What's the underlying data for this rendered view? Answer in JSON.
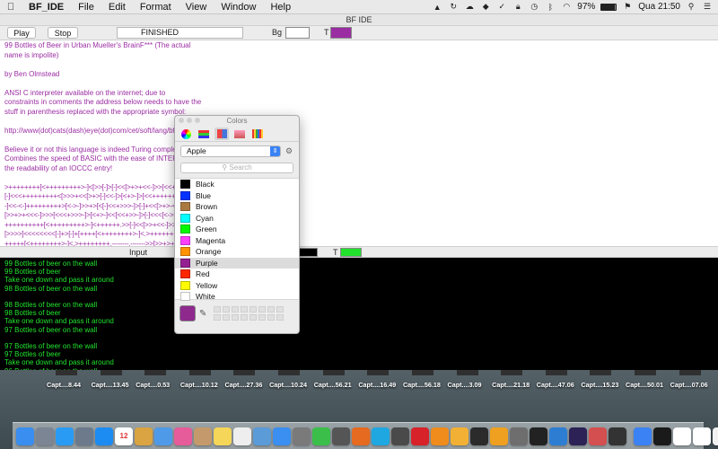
{
  "menubar": {
    "apple_glyph": "",
    "items": [
      "BF_IDE",
      "File",
      "Edit",
      "Format",
      "View",
      "Window",
      "Help"
    ],
    "battery": "97%",
    "clock": "Qua 21:50"
  },
  "window": {
    "title": "BF IDE",
    "play_label": "Play",
    "stop_label": "Stop",
    "status": "FINISHED",
    "bg_label": "Bg",
    "t_label": "T",
    "bg_color": "#ffffff",
    "t_color": "#9b2da3",
    "input_label": "Input",
    "input_bg_color": "#000000",
    "input_t_label": "T",
    "input_t_color": "#22e22e"
  },
  "editor": {
    "lines": [
      "99 Bottles of Beer in Urban Mueller's BrainF*** (The actual",
      "name is impolite)",
      "",
      "by Ben Olmstead",
      "",
      "ANSI C interpreter available on the internet; due to",
      "constraints in comments the address below needs to have the",
      "stuff in parenthesis replaced with the appropriate symbol:",
      "",
      "http://www(dot)cats(dash)eye(dot)com/cet/soft/lang/bf/",
      "",
      "Believe it or not this language is indeed Turing complete!",
      "Combines the speed of BASIC with the ease of INTERCAL and",
      "the readability of an IOCCC entry!",
      "",
      ">++++++++[<+++++++++>-]<[>>[-]>[-]<<[>+>+<<-]>>[<<+>>-]>>>",
      "[-]<<<+++++++++<[>>>+<<[>+>[-]<<-]>[<+>-]>[<<++++++++++>>>+<",
      "-]<<-<-]+++++++++>[<->-]>>+>[<[-]<<+>>>-]>[-]+<<[>+>-<<-]<<<",
      "[>>+>+<<<-]>>>[<<<+>>>-]>[<+>-]<<[<<+>>-]>[-]<<<[<->>+<<-]",
      "++++++++++[<+++++++++>-]<++++++.>>[-]<<[>>+<<-]>>[<<+>>-]<",
      "[>>>>]<<<<<<<<[-]+>[-]+[++++[<++++++++>-]<.>++++++++[<++++++",
      "+++++[<++++++++>-]<.>++++++++.--------.------->>[>>+>+<<<-]",
      ">>>[<<<+>>>-]<[<<<<+>>>>-]<[-]>[<+<+>>-]>>>>[-]<<<<<[<<<<",
      "+>-]<.>++++++++[<++++++++>-]<.-------------->>[-]<<<<<<<<"
    ]
  },
  "output": {
    "lines": [
      "99 Bottles of beer on the wall",
      "99 Bottles of beer",
      "Take one down and pass it around",
      "98 Bottles of beer on the wall",
      "",
      "98 Bottles of beer on the wall",
      "98 Bottles of beer",
      "Take one down and pass it around",
      "97 Bottles of beer on the wall",
      "",
      "97 Bottles of beer on the wall",
      "97 Bottles of beer",
      "Take one down and pass it around",
      "96 Bottles of beer on the wall",
      "",
      "96 Bottles of beer on the wall"
    ]
  },
  "colors_panel": {
    "title": "Colors",
    "palette": "Apple",
    "search_placeholder": "Search",
    "selected_color": "#8e2a8e",
    "items": [
      {
        "name": "Black",
        "color": "#000000"
      },
      {
        "name": "Blue",
        "color": "#0433ff"
      },
      {
        "name": "Brown",
        "color": "#aa7942"
      },
      {
        "name": "Cyan",
        "color": "#00fdff"
      },
      {
        "name": "Green",
        "color": "#00f900"
      },
      {
        "name": "Magenta",
        "color": "#ff40ff"
      },
      {
        "name": "Orange",
        "color": "#ff9300"
      },
      {
        "name": "Purple",
        "color": "#942192"
      },
      {
        "name": "Red",
        "color": "#ff2600"
      },
      {
        "name": "Yellow",
        "color": "#fffb00"
      },
      {
        "name": "White",
        "color": "#ffffff"
      }
    ],
    "selected_index": 7
  },
  "desktop": {
    "labels": [
      "Capt....8.44",
      "Capt....13.45",
      "Capt....0.53",
      "Capt....10.12",
      "Capt....27.36",
      "Capt....10.24",
      "Capt....56.21",
      "Capt....16.49",
      "Capt....56.18",
      "Capt....3.09",
      "Capt....21.18",
      "Capt....47.06",
      "Capt....15.23",
      "Capt....50.01",
      "Capt....07.06"
    ]
  },
  "dock": {
    "calendar_day": "12",
    "apps": [
      {
        "name": "finder",
        "color": "#3a8ef0"
      },
      {
        "name": "launchpad",
        "color": "#7b8594"
      },
      {
        "name": "safari",
        "color": "#2a9bf5"
      },
      {
        "name": "preview",
        "color": "#6c7a8c"
      },
      {
        "name": "app-store",
        "color": "#1d8cf2"
      },
      {
        "name": "calendar",
        "color": "#ffffff"
      },
      {
        "name": "photos",
        "color": "#d9a441"
      },
      {
        "name": "finder-2",
        "color": "#4e9ae8"
      },
      {
        "name": "itunes",
        "color": "#e65b9a"
      },
      {
        "name": "contacts",
        "color": "#c49a6c"
      },
      {
        "name": "notes",
        "color": "#f5d659"
      },
      {
        "name": "textedit",
        "color": "#eeeeee"
      },
      {
        "name": "mail",
        "color": "#5a9bd8"
      },
      {
        "name": "safari-2",
        "color": "#3a8ff0"
      },
      {
        "name": "system-preferences",
        "color": "#7a7a7a"
      },
      {
        "name": "facetime",
        "color": "#3bbf4a"
      },
      {
        "name": "calculator",
        "color": "#555555"
      },
      {
        "name": "firefox",
        "color": "#e66a1f"
      },
      {
        "name": "skype",
        "color": "#1ea7e1"
      },
      {
        "name": "sublime",
        "color": "#4a4a4a"
      },
      {
        "name": "opera",
        "color": "#d8222a"
      },
      {
        "name": "sublime-2",
        "color": "#f08c1c"
      },
      {
        "name": "sketch",
        "color": "#f2b134"
      },
      {
        "name": "activity",
        "color": "#2b2b2b"
      },
      {
        "name": "books",
        "color": "#f0a020"
      },
      {
        "name": "textmate",
        "color": "#6e6e6e"
      },
      {
        "name": "terminal",
        "color": "#222222"
      },
      {
        "name": "xcode",
        "color": "#2d7ed3"
      },
      {
        "name": "eclipse",
        "color": "#2c2255"
      },
      {
        "name": "grapher",
        "color": "#d44f4f"
      },
      {
        "name": "console",
        "color": "#333333"
      },
      {
        "name": "app-store-2",
        "color": "#3b82f5"
      },
      {
        "name": "terminal-2",
        "color": "#1a1a1a"
      },
      {
        "name": "window-1",
        "color": "#ffffff"
      },
      {
        "name": "window-2",
        "color": "#ffffff"
      },
      {
        "name": "window-3",
        "color": "#f2f2f2"
      }
    ]
  }
}
